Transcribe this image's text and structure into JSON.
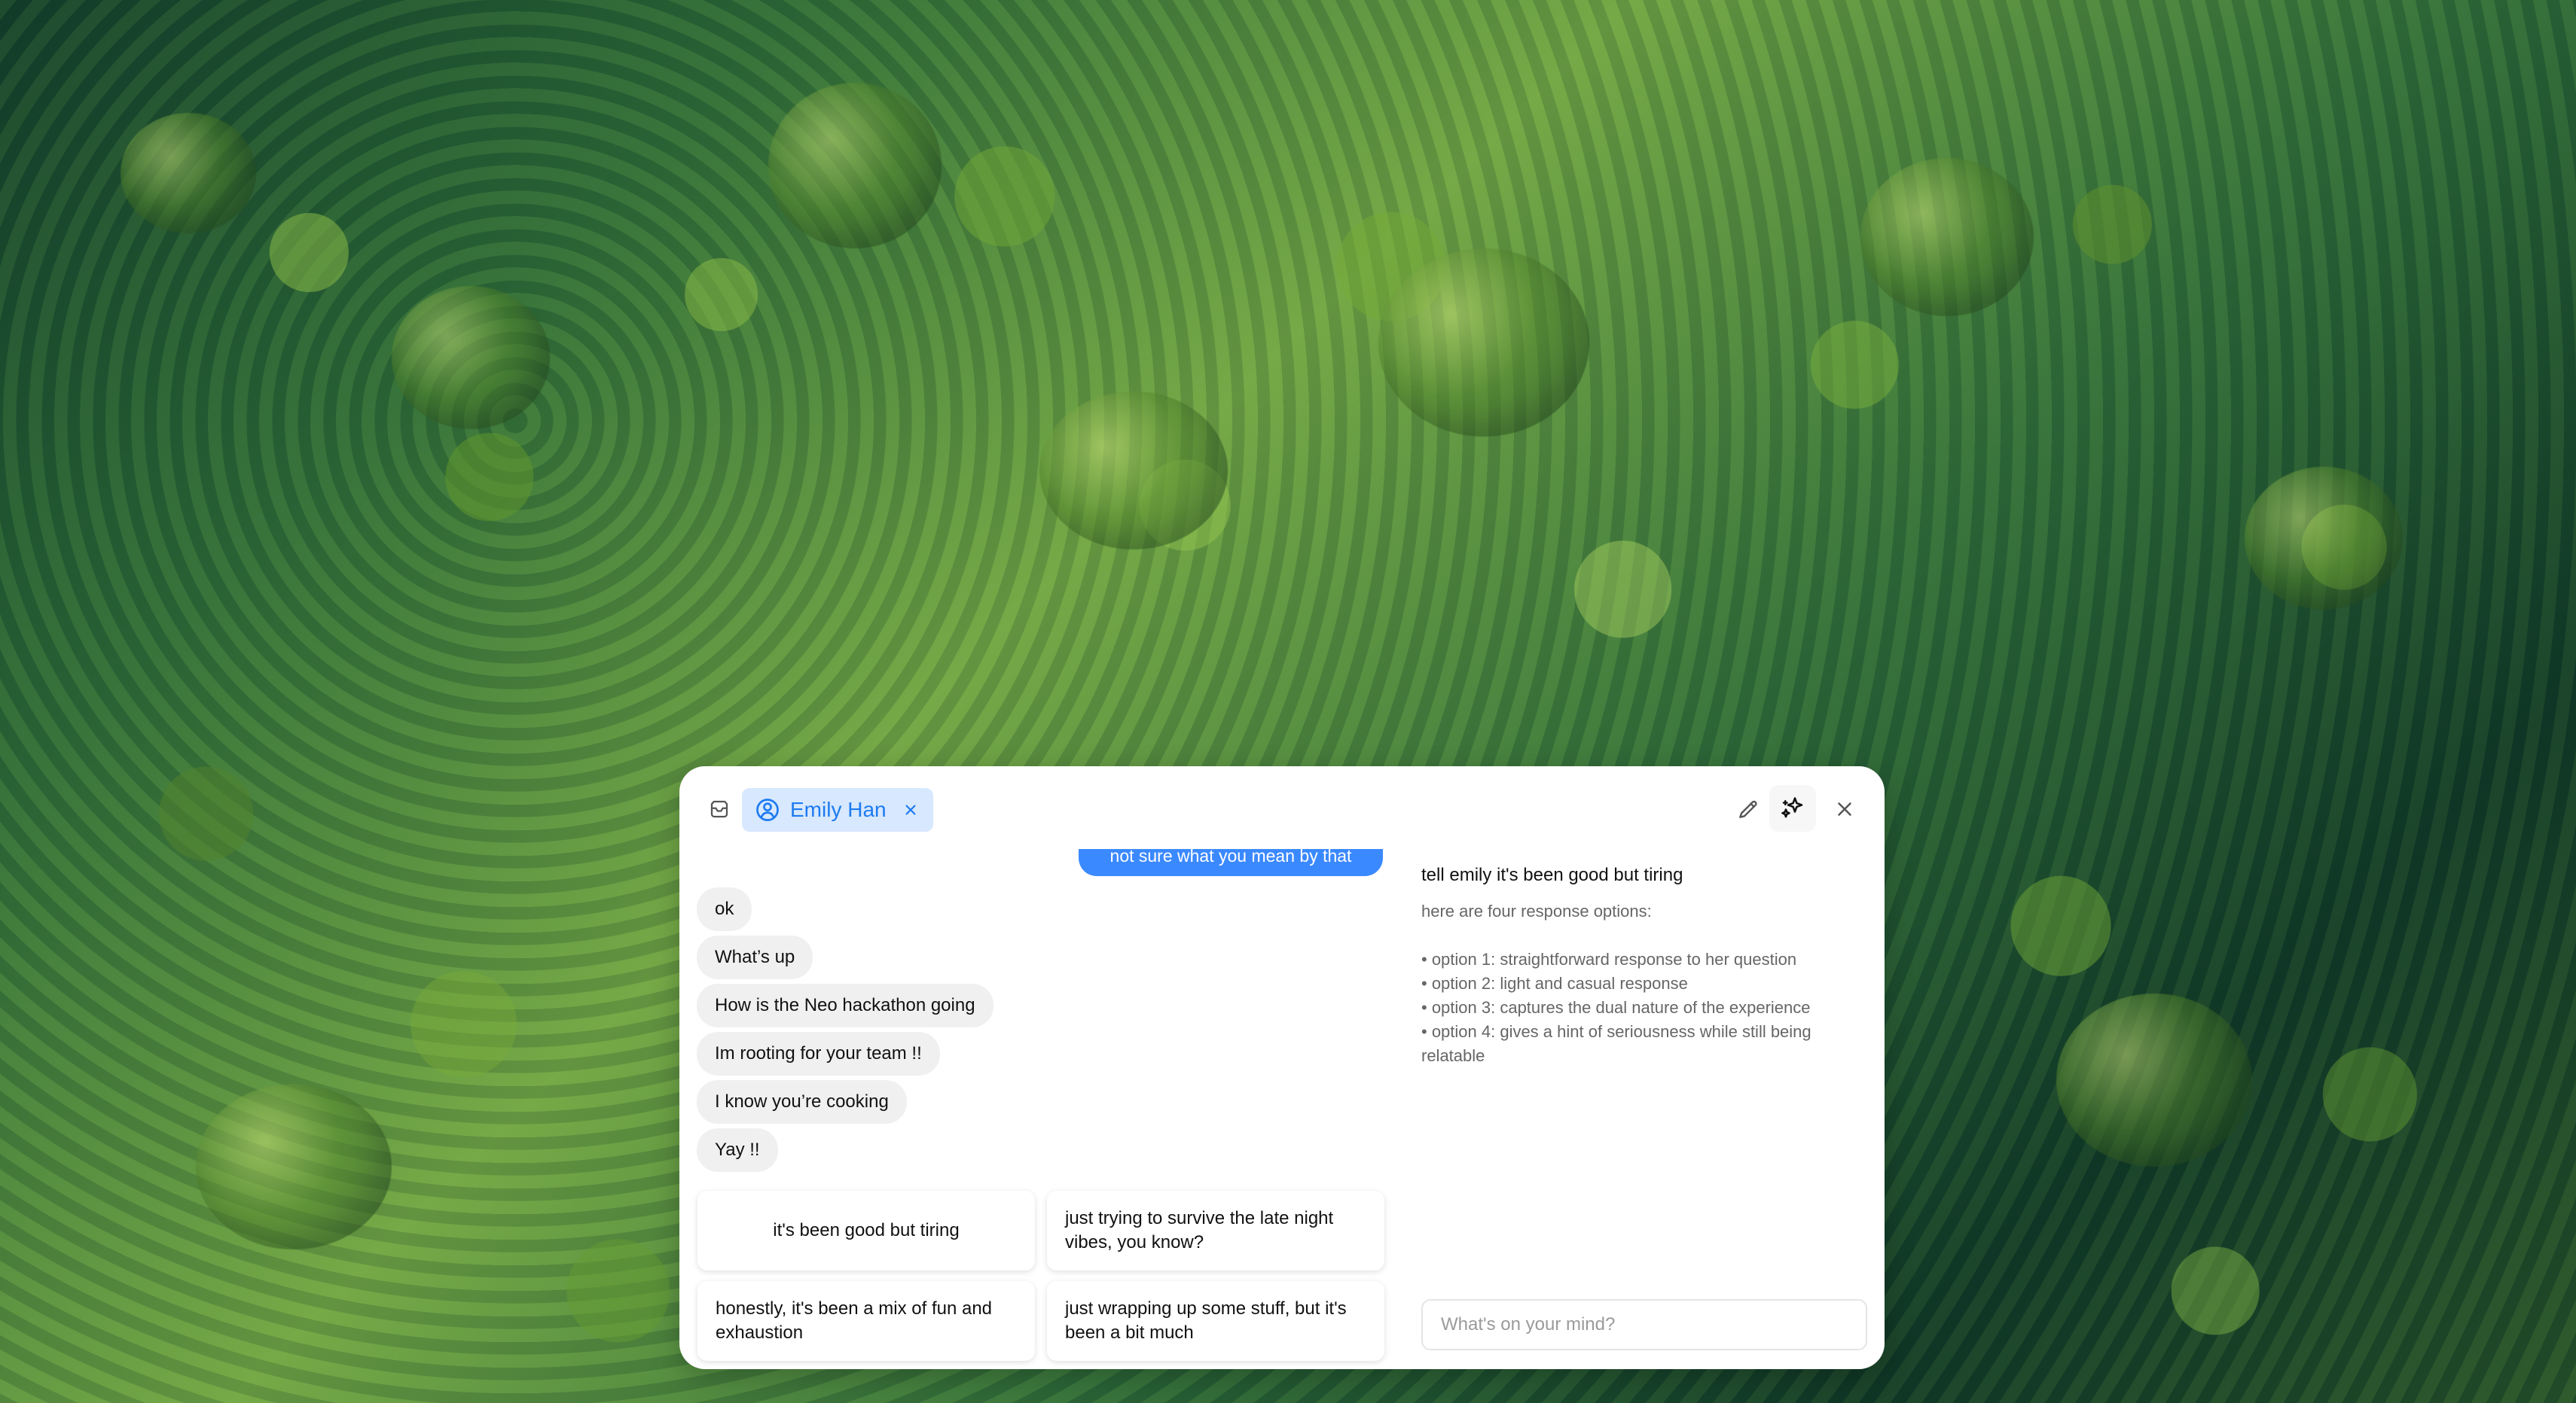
{
  "window": {
    "contact_chip": {
      "name": "Emily Han"
    },
    "icons": {
      "inbox": "inbox-icon",
      "contact": "person-circle-icon",
      "remove_contact": "close-icon",
      "edit": "pencil-icon",
      "ai": "sparkles-icon",
      "close": "close-icon"
    }
  },
  "chat": {
    "partial_sent_message": "not sure what you mean by that",
    "messages": [
      "ok",
      "What’s up",
      "How is the Neo hackathon going",
      "Im rooting for your team !!",
      "I know you’re cooking",
      "Yay !!"
    ],
    "suggestions": [
      "it's been good but tiring",
      "just trying to survive the late night vibes, you know?",
      "honestly, it's been a mix of fun and exhaustion",
      "just wrapping up some stuff, but it's been a bit much"
    ]
  },
  "assistant": {
    "prompt": "tell emily it's been good but tiring",
    "response_intro": "here are four response options:",
    "options": [
      "• option 1: straightforward response to her question",
      "• option 2: light and casual response",
      "• option 3: captures the dual nature of the experience",
      "• option 4: gives a hint of seriousness while still being relatable"
    ],
    "input_placeholder": "What's on your mind?"
  },
  "colors": {
    "accent": "#3b89ff",
    "chip_background": "#d7e8ff",
    "chip_text": "#1d7bf0",
    "message_bubble": "#f0f0f0"
  }
}
